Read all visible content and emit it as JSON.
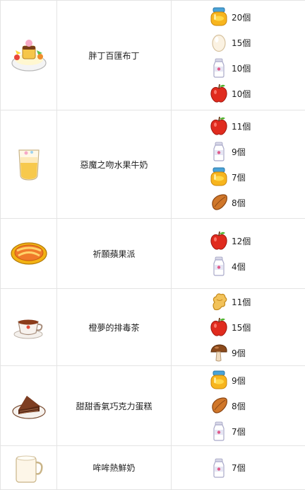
{
  "recipes": [
    {
      "name": "胖丁百匯布丁",
      "dish_icon": "pudding-parfait-icon",
      "ingredients": [
        {
          "icon": "honey-icon",
          "qty": "20個"
        },
        {
          "icon": "egg-icon",
          "qty": "15個"
        },
        {
          "icon": "milk-icon",
          "qty": "10個"
        },
        {
          "icon": "apple-icon",
          "qty": "10個"
        }
      ]
    },
    {
      "name": "惡魔之吻水果牛奶",
      "dish_icon": "fruit-milk-icon",
      "ingredients": [
        {
          "icon": "apple-icon",
          "qty": "11個"
        },
        {
          "icon": "milk-icon",
          "qty": "9個"
        },
        {
          "icon": "honey-icon",
          "qty": "7個"
        },
        {
          "icon": "cacao-icon",
          "qty": "8個"
        }
      ]
    },
    {
      "name": "祈願蘋果派",
      "dish_icon": "apple-pie-icon",
      "ingredients": [
        {
          "icon": "apple-icon",
          "qty": "12個"
        },
        {
          "icon": "milk-icon",
          "qty": "4個"
        }
      ]
    },
    {
      "name": "橙夢的排毒茶",
      "dish_icon": "tea-icon",
      "ingredients": [
        {
          "icon": "ginger-icon",
          "qty": "11個"
        },
        {
          "icon": "apple-icon",
          "qty": "15個"
        },
        {
          "icon": "mushroom-icon",
          "qty": "9個"
        }
      ]
    },
    {
      "name": "甜甜香氣巧克力蛋糕",
      "dish_icon": "chocolate-cake-icon",
      "ingredients": [
        {
          "icon": "honey-icon",
          "qty": "9個"
        },
        {
          "icon": "cacao-icon",
          "qty": "8個"
        },
        {
          "icon": "milk-icon",
          "qty": "7個"
        }
      ]
    },
    {
      "name": "哞哞熱鮮奶",
      "dish_icon": "hot-milk-icon",
      "ingredients": [
        {
          "icon": "milk-icon",
          "qty": "7個"
        }
      ]
    }
  ]
}
